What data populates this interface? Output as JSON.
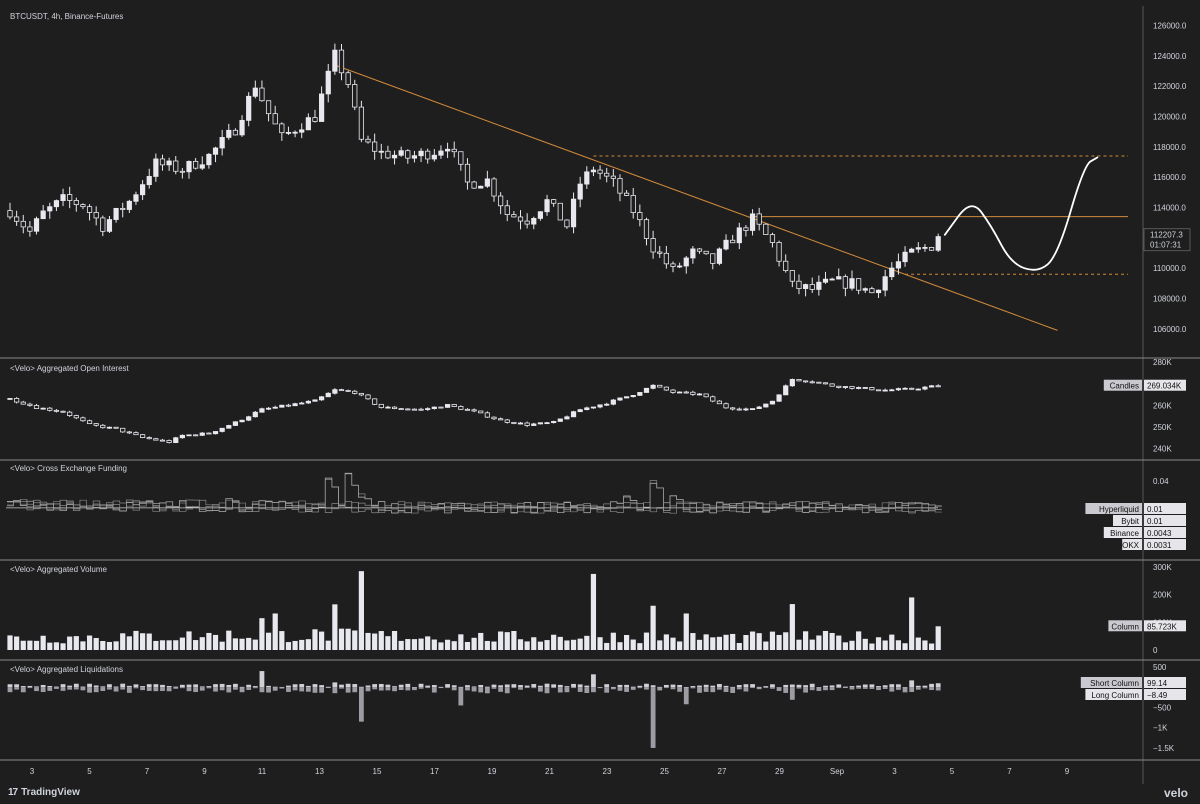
{
  "header": {
    "symbol_label": "BTCUSDT, 4h, Binance-Futures",
    "last_price": "112207.3",
    "countdown": "01:07:31"
  },
  "footer": {
    "brand": "TradingView",
    "brand_icon": "tradingview-logo-icon",
    "velo": "velo"
  },
  "colors": {
    "background": "#1e1e1e",
    "up_candle": "#e8e8ef",
    "down_candle": "#1e1e1e",
    "trendline": "#d08a3a",
    "annotation": "#ffffff",
    "text": "#d1d4dc",
    "separator": "#8a8a8a"
  },
  "chart_data": [
    {
      "id": "price",
      "type": "candlestick",
      "title": "BTCUSDT, 4h, Binance-Futures",
      "ylim": [
        105000,
        126500
      ],
      "y_ticks": [
        106000,
        108000,
        110000,
        112000,
        114000,
        116000,
        118000,
        120000,
        122000,
        124000,
        126000
      ],
      "x_ticks": [
        "3",
        "5",
        "7",
        "9",
        "11",
        "13",
        "15",
        "17",
        "19",
        "21",
        "23",
        "25",
        "27",
        "29",
        "Sep",
        "3",
        "5",
        "7",
        "9"
      ],
      "close_path": [
        [
          0,
          113800
        ],
        [
          3,
          112400
        ],
        [
          5,
          113600
        ],
        [
          8,
          114500
        ],
        [
          11,
          114200
        ],
        [
          14,
          112800
        ],
        [
          18,
          114400
        ],
        [
          22,
          116900
        ],
        [
          26,
          116500
        ],
        [
          30,
          117400
        ],
        [
          34,
          119200
        ],
        [
          37,
          122100
        ],
        [
          39,
          120200
        ],
        [
          41,
          118600
        ],
        [
          44,
          119500
        ],
        [
          46,
          120000
        ],
        [
          49,
          124000
        ],
        [
          51,
          122200
        ],
        [
          53,
          118400
        ],
        [
          56,
          117600
        ],
        [
          60,
          117300
        ],
        [
          64,
          117700
        ],
        [
          66,
          118200
        ],
        [
          69,
          115600
        ],
        [
          72,
          115800
        ],
        [
          75,
          113600
        ],
        [
          78,
          113200
        ],
        [
          81,
          114400
        ],
        [
          84,
          112800
        ],
        [
          86,
          115600
        ],
        [
          88,
          116600
        ],
        [
          91,
          115600
        ],
        [
          94,
          113800
        ],
        [
          97,
          111400
        ],
        [
          100,
          109800
        ],
        [
          103,
          111000
        ],
        [
          106,
          110400
        ],
        [
          109,
          112000
        ],
        [
          112,
          113200
        ],
        [
          115,
          111600
        ],
        [
          118,
          108800
        ],
        [
          121,
          108600
        ],
        [
          124,
          109100
        ],
        [
          127,
          109000
        ],
        [
          130,
          108400
        ],
        [
          133,
          110000
        ],
        [
          136,
          111000
        ],
        [
          139,
          111500
        ],
        [
          140,
          112207
        ]
      ],
      "annotations": {
        "trendline": {
          "from": [
            49,
            123400
          ],
          "to": [
            158,
            105900
          ]
        },
        "level_dashed_high": 117400,
        "level_solid_mid": 113400,
        "level_dashed_low": 109600,
        "projection": [
          [
            141,
            112200
          ],
          [
            145,
            114600
          ],
          [
            148,
            112800
          ],
          [
            151,
            110300
          ],
          [
            155,
            109700
          ],
          [
            158,
            110800
          ],
          [
            162,
            116800
          ],
          [
            164,
            117300
          ]
        ]
      }
    },
    {
      "id": "open_interest",
      "type": "candlestick",
      "title": "<Velo> Aggregated Open Interest",
      "ylim": [
        237000,
        280000
      ],
      "y_ticks": [
        240000,
        250000,
        260000,
        270000,
        280000
      ],
      "y_tick_labels": [
        "240K",
        "250K",
        "260K",
        "270K",
        "280K"
      ],
      "close_path": [
        [
          0,
          263000
        ],
        [
          4,
          259000
        ],
        [
          8,
          257000
        ],
        [
          12,
          251000
        ],
        [
          16,
          249000
        ],
        [
          20,
          245000
        ],
        [
          24,
          243000
        ],
        [
          26,
          246000
        ],
        [
          30,
          247000
        ],
        [
          34,
          252000
        ],
        [
          38,
          258000
        ],
        [
          42,
          260000
        ],
        [
          46,
          262000
        ],
        [
          49,
          267000
        ],
        [
          52,
          266000
        ],
        [
          56,
          259000
        ],
        [
          62,
          258000
        ],
        [
          66,
          260000
        ],
        [
          70,
          257000
        ],
        [
          74,
          253000
        ],
        [
          78,
          251000
        ],
        [
          82,
          252000
        ],
        [
          86,
          258000
        ],
        [
          90,
          261000
        ],
        [
          94,
          265000
        ],
        [
          97,
          269000
        ],
        [
          100,
          266000
        ],
        [
          104,
          265000
        ],
        [
          108,
          259000
        ],
        [
          112,
          258000
        ],
        [
          115,
          262000
        ],
        [
          118,
          272000
        ],
        [
          121,
          271000
        ],
        [
          124,
          269000
        ],
        [
          128,
          268000
        ],
        [
          132,
          267000
        ],
        [
          136,
          267500
        ],
        [
          140,
          269000
        ]
      ],
      "legend": [
        {
          "label": "Candles",
          "value": "269.034K"
        }
      ]
    },
    {
      "id": "funding",
      "type": "step-line",
      "title": "<Velo> Cross Exchange Funding",
      "ylim": [
        -0.0065,
        0.0055
      ],
      "y_ticks": [
        0.04
      ],
      "y_tick_labels": [
        "0.04"
      ],
      "base_path": [
        [
          0,
          0.0006
        ],
        [
          20,
          0.0004
        ],
        [
          40,
          0.0003
        ],
        [
          50,
          0.0002
        ],
        [
          70,
          0.0001
        ],
        [
          90,
          0.0002
        ],
        [
          105,
          0.0001
        ],
        [
          120,
          0.0002
        ],
        [
          140,
          0.0001
        ]
      ],
      "spikes": [
        [
          33,
          0.0014
        ],
        [
          48,
          0.0048
        ],
        [
          51,
          0.0052
        ],
        [
          53,
          0.0021
        ],
        [
          93,
          0.0017
        ],
        [
          97,
          0.0046
        ],
        [
          100,
          0.0019
        ]
      ],
      "legend": [
        {
          "label": "Hyperliquid",
          "value": "0.01"
        },
        {
          "label": "Bybit",
          "value": "0.01"
        },
        {
          "label": "Binance",
          "value": "0.0043"
        },
        {
          "label": "OKX",
          "value": "0.0031"
        }
      ]
    },
    {
      "id": "volume",
      "type": "bar",
      "title": "<Velo> Aggregated Volume",
      "ylim": [
        0,
        300000
      ],
      "y_ticks": [
        0,
        100000,
        200000,
        300000
      ],
      "y_tick_labels": [
        "0",
        "100K",
        "200K",
        "300K"
      ],
      "level": [
        [
          0,
          48000
        ],
        [
          20,
          54000
        ],
        [
          40,
          60000
        ],
        [
          55,
          58000
        ],
        [
          70,
          50000
        ],
        [
          90,
          55000
        ],
        [
          110,
          50000
        ],
        [
          130,
          52000
        ],
        [
          140,
          48000
        ]
      ],
      "spikes": [
        [
          38,
          115000
        ],
        [
          40,
          132000
        ],
        [
          49,
          165000
        ],
        [
          53,
          285000
        ],
        [
          88,
          275000
        ],
        [
          97,
          160000
        ],
        [
          102,
          132000
        ],
        [
          118,
          166000
        ],
        [
          136,
          190000
        ],
        [
          140,
          85723
        ]
      ],
      "legend": [
        {
          "label": "Column",
          "value": "85.723K"
        }
      ]
    },
    {
      "id": "liquidations",
      "type": "bar",
      "title": "<Velo> Aggregated Liquidations",
      "ylim": [
        -1600,
        550
      ],
      "y_ticks": [
        500,
        0,
        -500,
        -1000,
        -1500
      ],
      "y_tick_labels": [
        "500",
        "0",
        "−500",
        "−1K",
        "−1.5K"
      ],
      "short_spikes": [
        [
          38,
          400
        ],
        [
          49,
          120
        ],
        [
          88,
          320
        ],
        [
          136,
          170
        ],
        [
          140,
          99.14
        ]
      ],
      "long_spikes": [
        [
          53,
          -850
        ],
        [
          68,
          -450
        ],
        [
          97,
          -1500
        ],
        [
          102,
          -420
        ],
        [
          118,
          -310
        ]
      ],
      "legend": [
        {
          "label": "Short Column",
          "value": "99.14"
        },
        {
          "label": "Long Column",
          "value": "−8.49"
        }
      ]
    }
  ]
}
